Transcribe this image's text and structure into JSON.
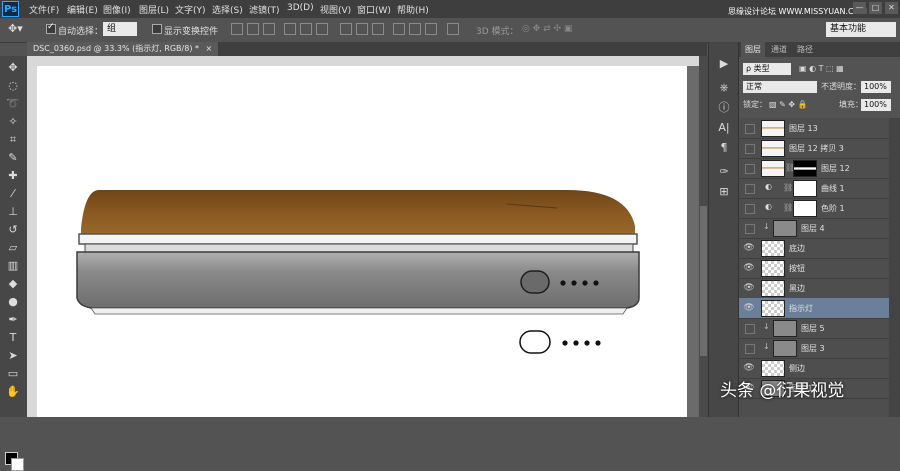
{
  "app": {
    "logo": "Ps"
  },
  "menubar": {
    "items": [
      "文件(F)",
      "编辑(E)",
      "图像(I)",
      "图层(L)",
      "文字(Y)",
      "选择(S)",
      "滤镜(T)",
      "3D(D)",
      "视图(V)",
      "窗口(W)",
      "帮助(H)"
    ],
    "watermark": "思缘设计论坛 WWW.MISSYUAN.COM",
    "window_controls": [
      "—",
      "□",
      "✕"
    ]
  },
  "options_bar": {
    "auto_select_label": "自动选择：",
    "auto_select_value": "组",
    "show_transform_label": "显示变换控件",
    "mode_3d_label": "3D 模式：",
    "workspace": "基本功能"
  },
  "document": {
    "tab_title": "DSC_0360.psd @ 33.3% (指示灯, RGB/8) *",
    "tab_close": "×",
    "colors": {
      "top_leather": "#8a5a22",
      "body": "#8c8c8c",
      "canvas_bg": "#ffffff"
    }
  },
  "layers_panel": {
    "tabs": [
      "图层",
      "通道",
      "路径"
    ],
    "filter_kind": "ρ 类型",
    "blend_mode": "正常",
    "opacity_label": "不透明度：",
    "opacity_value": "100%",
    "lock_label": "锁定：",
    "fill_label": "填充：",
    "fill_value": "100%",
    "layers": [
      {
        "name": "图层 13",
        "visible": false,
        "thumb": "gradient"
      },
      {
        "name": "图层 12 拷贝 3",
        "visible": false,
        "thumb": "gradient"
      },
      {
        "name": "图层 12",
        "visible": false,
        "thumb": "gradient",
        "mask": true
      },
      {
        "name": "曲线 1",
        "visible": false,
        "thumb": "adjust",
        "mask": true
      },
      {
        "name": "色阶 1",
        "visible": false,
        "thumb": "adjust",
        "mask": true
      },
      {
        "name": "图层 4",
        "visible": false,
        "thumb": "gray"
      },
      {
        "name": "底边",
        "visible": true,
        "thumb": "checker"
      },
      {
        "name": "按钮",
        "visible": true,
        "thumb": "checker"
      },
      {
        "name": "黑边",
        "visible": true,
        "thumb": "checker"
      },
      {
        "name": "指示灯",
        "visible": true,
        "thumb": "checker",
        "selected": true
      },
      {
        "name": "图层 5",
        "visible": false,
        "thumb": "gray"
      },
      {
        "name": "图层 3",
        "visible": false,
        "thumb": "gray"
      },
      {
        "name": "侧边",
        "visible": true,
        "thumb": "checker"
      },
      {
        "name": "图层 1",
        "visible": true,
        "thumb": "gray"
      }
    ]
  },
  "overlay": {
    "brand": "头条 @衍果视觉"
  }
}
